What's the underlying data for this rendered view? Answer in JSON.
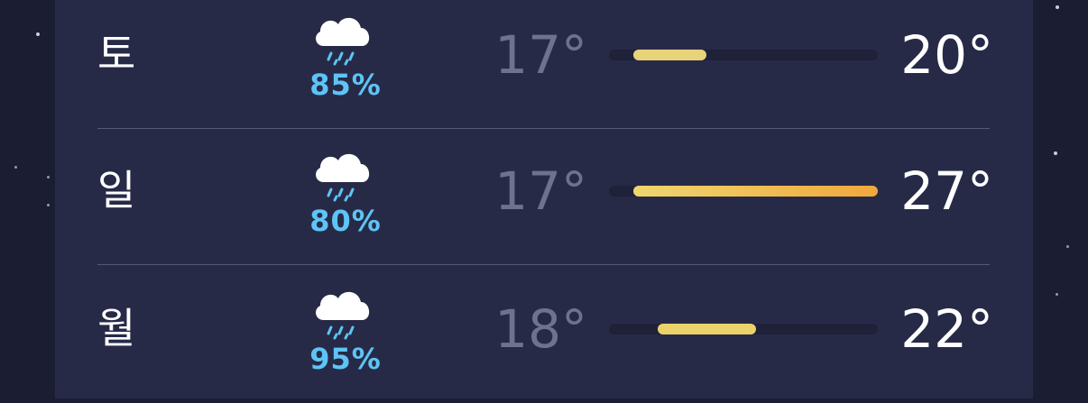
{
  "forecast": {
    "range_min": 16,
    "range_max": 27,
    "rows": [
      {
        "day": "토",
        "icon": "rain-cloud-icon",
        "precip": "85%",
        "low": "17°",
        "high": "20°",
        "low_value": 17,
        "high_value": 20,
        "bar_colors": [
          "#e8d27a",
          "#e8d27a"
        ]
      },
      {
        "day": "일",
        "icon": "rain-cloud-icon",
        "precip": "80%",
        "low": "17°",
        "high": "27°",
        "low_value": 17,
        "high_value": 27,
        "bar_colors": [
          "#efd670",
          "#f0a83c"
        ]
      },
      {
        "day": "월",
        "icon": "rain-cloud-icon",
        "precip": "95%",
        "low": "18°",
        "high": "22°",
        "low_value": 18,
        "high_value": 22,
        "bar_colors": [
          "#ecd26a",
          "#ecd26a"
        ]
      }
    ]
  },
  "colors": {
    "panel_bg": "#272a47",
    "page_bg": "#1b1d33",
    "precip_text": "#5ec4f5",
    "low_temp_text": "#6e7190"
  }
}
